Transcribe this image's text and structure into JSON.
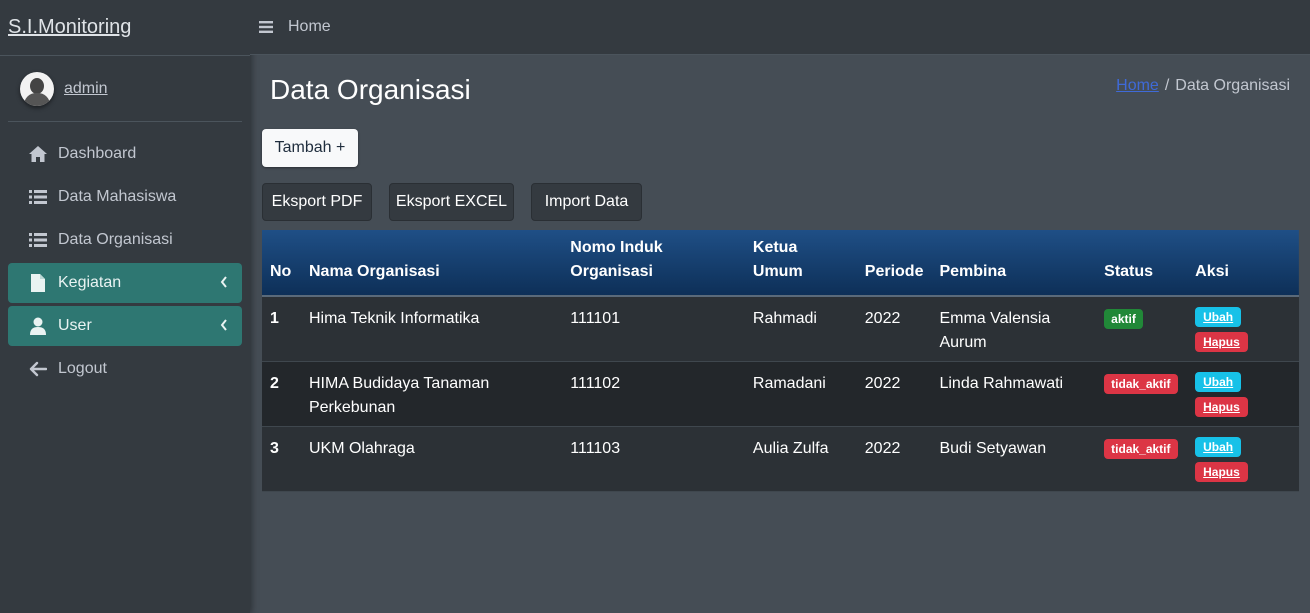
{
  "brand": "S.I.Monitoring",
  "user": {
    "name": "admin"
  },
  "sidebar": {
    "items": [
      {
        "label": "Dashboard",
        "icon": "home-icon"
      },
      {
        "label": "Data Mahasiswa",
        "icon": "list-icon"
      },
      {
        "label": "Data Organisasi",
        "icon": "list-icon"
      },
      {
        "label": "Kegiatan",
        "icon": "file-icon"
      },
      {
        "label": "User",
        "icon": "user-icon"
      },
      {
        "label": "Logout",
        "icon": "arrow-left-icon"
      }
    ]
  },
  "topbar": {
    "home": "Home"
  },
  "page": {
    "title": "Data Organisasi",
    "breadcrumb_home": "Home",
    "breadcrumb_sep": "/",
    "breadcrumb_current": "Data Organisasi"
  },
  "buttons": {
    "add": "Tambah +",
    "export_pdf": "Eksport PDF",
    "export_excel": "Eksport EXCEL",
    "import": "Import Data"
  },
  "table": {
    "headers": [
      "No",
      "Nama Organisasi",
      "Nomo Induk Organisasi",
      "Ketua Umum",
      "Periode",
      "Pembina",
      "Status",
      "Aksi"
    ],
    "rows": [
      {
        "no": "1",
        "nama": "Hima Teknik Informatika",
        "nomor": "111101",
        "ketua": "Rahmadi",
        "periode": "2022",
        "pembina": "Emma Valensia Aurum",
        "status": "aktif"
      },
      {
        "no": "2",
        "nama": "HIMA Budidaya Tanaman Perkebunan",
        "nomor": "111102",
        "ketua": "Ramadani",
        "periode": "2022",
        "pembina": "Linda Rahmawati",
        "status": "tidak_aktif"
      },
      {
        "no": "3",
        "nama": "UKM Olahraga",
        "nomor": "111103",
        "ketua": "Aulia Zulfa",
        "periode": "2022",
        "pembina": "Budi Setyawan",
        "status": "tidak_aktif"
      }
    ],
    "edit_label": "Ubah",
    "delete_label": "Hapus"
  },
  "colors": {
    "active_nav": "#2e7772",
    "header_blue": "#1f4f86",
    "status_active": "#218838",
    "status_inactive": "#dc3545",
    "edit": "#17c1e8"
  }
}
